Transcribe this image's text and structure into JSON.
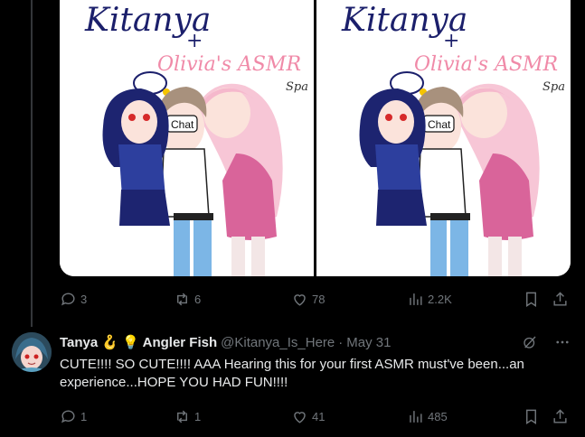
{
  "tweet1": {
    "image": {
      "title": "Kitanya",
      "plus": "+",
      "subtitle": "Olivia's ASMR",
      "tag": "Spa",
      "bubble": "Chat"
    },
    "actions": {
      "replies": "3",
      "reposts": "6",
      "likes": "78",
      "views": "2.2K"
    }
  },
  "tweet2": {
    "author": {
      "name": "Tanya",
      "emoji1": "🪝",
      "emoji2": "💡",
      "name_suffix": "Angler Fish",
      "handle": "@Kitanya_Is_Here",
      "separator": "·",
      "date": "May 31"
    },
    "text": "CUTE!!!! SO CUTE!!!! AAA Hearing this for your first ASMR must've been...an experience...HOPE YOU HAD FUN!!!!",
    "actions": {
      "replies": "1",
      "reposts": "1",
      "likes": "41",
      "views": "485"
    }
  },
  "icons": {
    "reply": "reply-icon",
    "repost": "repost-icon",
    "like": "like-icon",
    "views": "views-icon",
    "bookmark": "bookmark-icon",
    "share": "share-icon",
    "grok": "grok-icon",
    "more": "more-icon"
  },
  "colors": {
    "background": "#000000",
    "text": "#e7e9ea",
    "muted": "#71767b",
    "border": "#333639"
  }
}
